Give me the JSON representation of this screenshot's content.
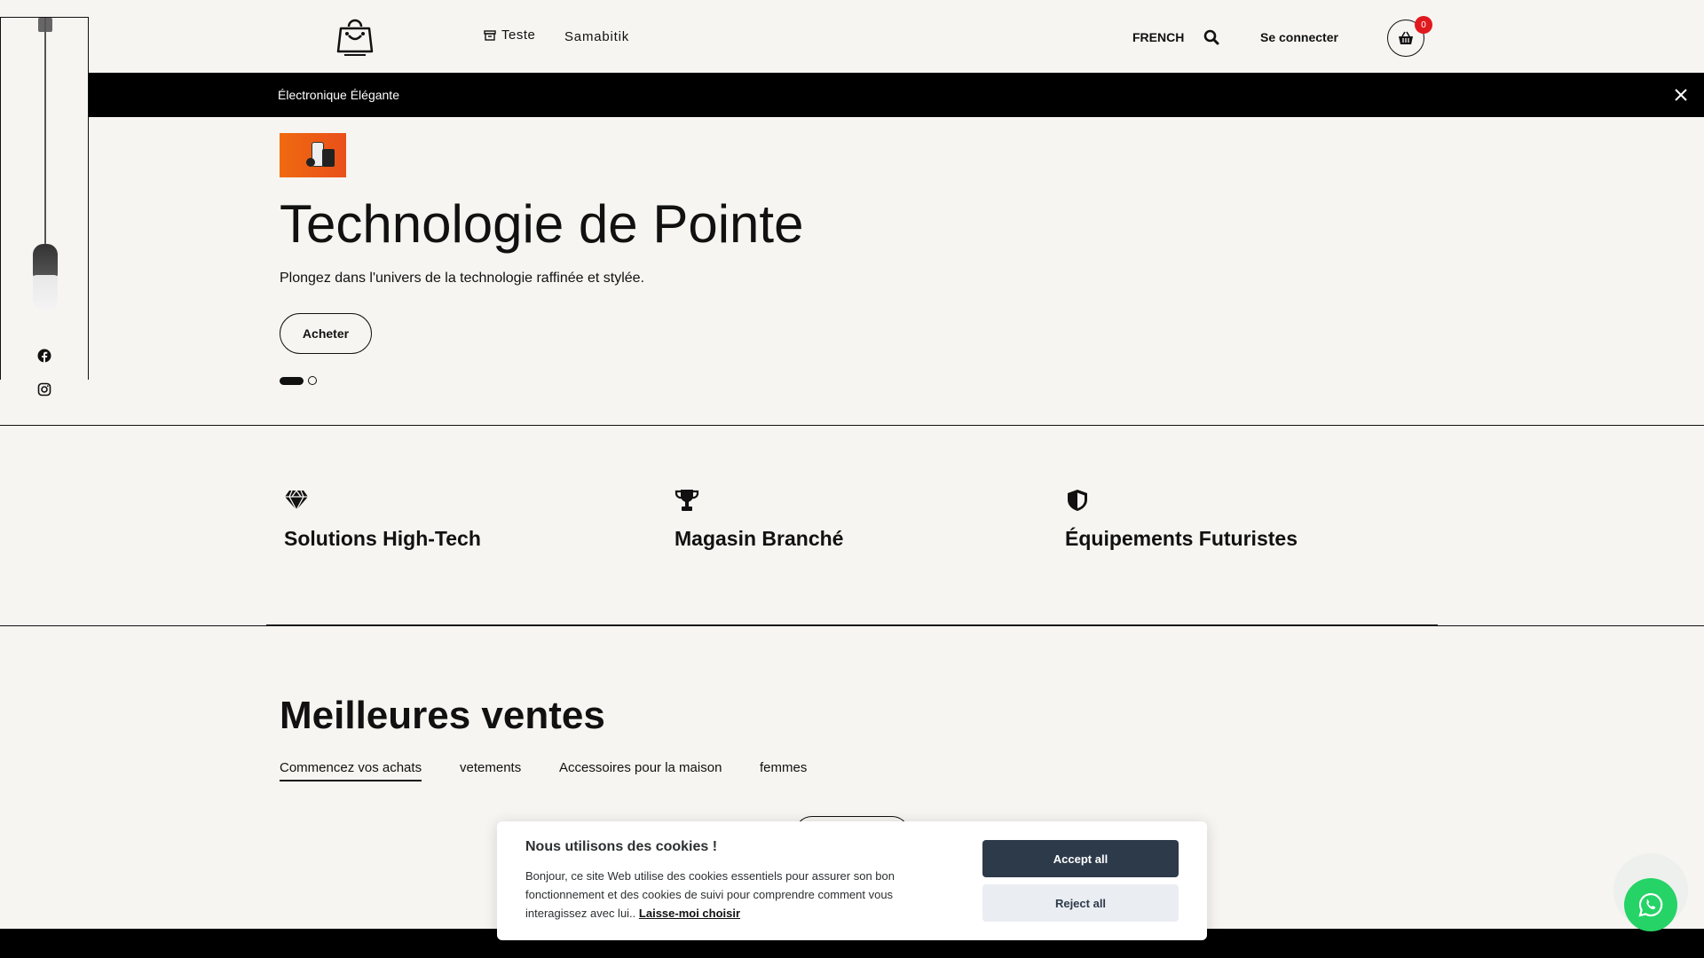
{
  "header": {
    "nav": {
      "teste": "Teste",
      "samabitik": "Samabitik"
    },
    "language": "FRENCH",
    "login": "Se connecter",
    "cart_count": "0"
  },
  "announcement": {
    "text": "Électronique Élégante"
  },
  "hero": {
    "title": "Technologie de Pointe",
    "subtitle": "Plongez dans l'univers de la technologie raffinée et stylée.",
    "cta": "Acheter",
    "slide_count": 2,
    "active_slide": 1
  },
  "features": [
    {
      "title": "Solutions High-Tech",
      "icon": "diamond-icon"
    },
    {
      "title": "Magasin Branché",
      "icon": "trophy-icon"
    },
    {
      "title": "Équipements Futuristes",
      "icon": "shield-icon"
    }
  ],
  "best_sellers": {
    "title": "Meilleures ventes",
    "tabs": [
      "Commencez vos achats",
      "vetements",
      "Accessoires pour la maison",
      "femmes"
    ],
    "active_tab": 0
  },
  "cookie": {
    "title": "Nous utilisons des cookies !",
    "text": "Bonjour, ce site Web utilise des cookies essentiels pour assurer son bon fonctionnement et des cookies de suivi pour comprendre comment vous interagissez avec lui..",
    "link": "Laisse-moi choisir",
    "accept": "Accept all",
    "reject": "Reject all"
  },
  "colors": {
    "background": "#f6f5f1",
    "badge": "#e0191f",
    "accept_button": "#2d3a4a",
    "whatsapp": "#25d366"
  }
}
